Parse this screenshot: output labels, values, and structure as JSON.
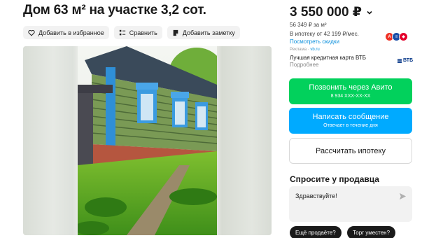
{
  "listing": {
    "title": "Дом 63 м² на участке 3,2 сот.",
    "photo_alt": "Деревянный дом с голубыми наличниками"
  },
  "actions": {
    "favorite": "Добавить в избранное",
    "compare": "Сравнить",
    "note": "Добавить заметку"
  },
  "price": {
    "value": "3 550 000 ₽",
    "per_m2": "56 349 ₽ за м²"
  },
  "mortgage": {
    "text": "В ипотеку от 42 199 ₽/мес.",
    "link": "Посмотреть скидки"
  },
  "ad": {
    "label": "Реклама",
    "brand": "vb.ru",
    "title": "Лучшая кредитная карта ВТБ",
    "more": "Подробнее",
    "logo_text": "ВТБ"
  },
  "buttons": {
    "call_label": "Позвонить через Авито",
    "call_phone": "8 934 XXX-XX-XX",
    "message_label": "Написать сообщение",
    "message_sub": "Отвечает в течение дня",
    "mortgage_label": "Рассчитать ипотеку"
  },
  "ask": {
    "title": "Спросите у продавца",
    "input_value": "Здравствуйте!",
    "quick_1": "Ещё продаёте?",
    "quick_2": "Торг уместен?"
  },
  "colors": {
    "call": "#02d15c",
    "message": "#00aaff",
    "link": "#0a8fdc"
  }
}
